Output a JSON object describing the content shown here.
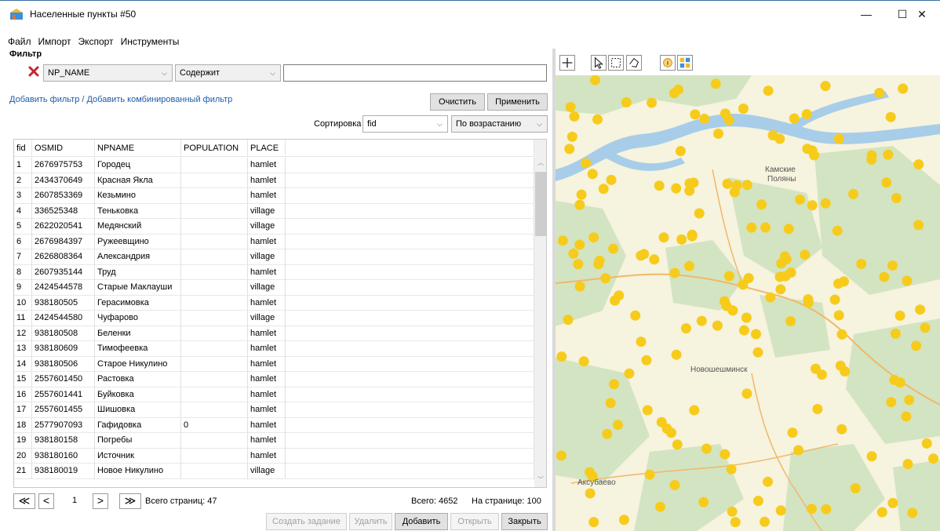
{
  "window": {
    "title": "Населенные пункты #50",
    "minimize": "—",
    "maximize": "☐",
    "close": "✕"
  },
  "menu": [
    "Файл",
    "Импорт",
    "Экспорт",
    "Инструменты"
  ],
  "filter": {
    "label": "Фильтр",
    "field_value": "NP_NAME",
    "operator_value": "Содержит",
    "text_value": "",
    "add_filter_link": "Добавить фильтр",
    "link_separator": " / ",
    "add_combined_link": "Добавить комбинированный фильтр",
    "clear_button": "Очистить",
    "apply_button": "Применить"
  },
  "sort": {
    "label": "Сортировка",
    "field": "fid",
    "order": "По возрастанию"
  },
  "table": {
    "columns": [
      "fid",
      "OSMID",
      "NPNAME",
      "POPULATION",
      "PLACE"
    ],
    "rows": [
      [
        "1",
        "2676975753",
        "Городец",
        "",
        "hamlet"
      ],
      [
        "2",
        "2434370649",
        "Красная Якла",
        "",
        "hamlet"
      ],
      [
        "3",
        "2607853369",
        "Кезьмино",
        "",
        "hamlet"
      ],
      [
        "4",
        "336525348",
        "Теньковка",
        "",
        "village"
      ],
      [
        "5",
        "2622020541",
        "Медянский",
        "",
        "village"
      ],
      [
        "6",
        "2676984397",
        "Ружеевщино",
        "",
        "hamlet"
      ],
      [
        "7",
        "2626808364",
        "Александрия",
        "",
        "village"
      ],
      [
        "8",
        "2607935144",
        "Труд",
        "",
        "hamlet"
      ],
      [
        "9",
        "2424544578",
        "Старые Маклауши",
        "",
        "village"
      ],
      [
        "10",
        "938180505",
        "Герасимовка",
        "",
        "hamlet"
      ],
      [
        "11",
        "2424544580",
        "Чуфарово",
        "",
        "village"
      ],
      [
        "12",
        "938180508",
        "Беленки",
        "",
        "hamlet"
      ],
      [
        "13",
        "938180609",
        "Тимофеевка",
        "",
        "hamlet"
      ],
      [
        "14",
        "938180506",
        "Старое Никулино",
        "",
        "hamlet"
      ],
      [
        "15",
        "2557601450",
        "Растовка",
        "",
        "hamlet"
      ],
      [
        "16",
        "2557601441",
        "Буйковка",
        "",
        "hamlet"
      ],
      [
        "17",
        "2557601455",
        "Шишовка",
        "",
        "hamlet"
      ],
      [
        "18",
        "2577907093",
        "Гафидовка",
        "0",
        "hamlet"
      ],
      [
        "19",
        "938180158",
        "Погребы",
        "",
        "hamlet"
      ],
      [
        "20",
        "938180160",
        "Источник",
        "",
        "hamlet"
      ],
      [
        "21",
        "938180019",
        "Новое Никулино",
        "",
        "village"
      ]
    ]
  },
  "pager": {
    "first": "≪",
    "prev": "<",
    "page": "1",
    "next": ">",
    "last": "≫",
    "total_pages": "Всего страниц: 47",
    "total": "Всего: 4652",
    "per_page": "На странице: 100"
  },
  "actions": {
    "create": "Создать задание",
    "delete": "Удалить",
    "add": "Добавить",
    "open": "Открыть",
    "close": "Закрыть"
  },
  "map": {
    "labels": {
      "kamskie_1": "Камские",
      "kamskie_2": "Поляны",
      "novosheshminsk": "Новошешминск",
      "aksubaevo": "Аксубаево"
    },
    "colors": {
      "background": "#f6f3de",
      "forest": "#d3e4c2",
      "water": "#a7cde9",
      "point": "#f7cb1b",
      "road": "#f0b86a"
    },
    "tools": [
      "plus-icon",
      "pointer-icon",
      "rect-select-icon",
      "lasso-icon",
      "info-icon",
      "zoom-extent-icon"
    ]
  }
}
